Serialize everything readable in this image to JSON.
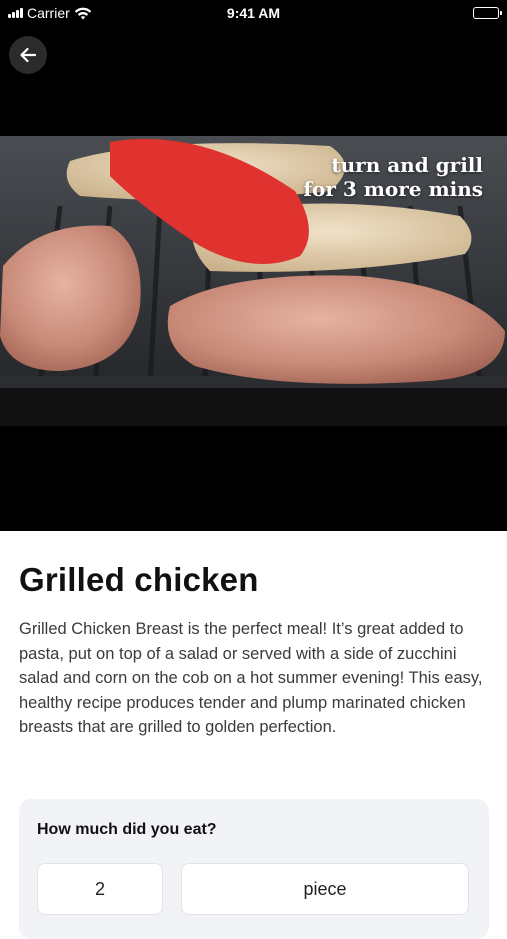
{
  "status_bar": {
    "carrier": "Carrier",
    "time": "9:41 AM"
  },
  "hero": {
    "caption_line1": "turn and grill",
    "caption_line2": "for 3 more mins"
  },
  "recipe": {
    "title": "Grilled chicken",
    "description": "Grilled Chicken Breast is the perfect meal!  It’s great added to pasta, put on top of a salad or served with a side of zucchini salad and corn on the cob on a hot summer evening! This easy, healthy recipe produces tender and plump marinated chicken breasts that are grilled to golden perfection."
  },
  "portion": {
    "question": "How much did you eat?",
    "quantity": "2",
    "unit": "piece"
  },
  "icons": {
    "back": "arrow-left-icon",
    "wifi": "wifi-icon",
    "battery": "battery-icon",
    "signal": "signal-icon"
  }
}
